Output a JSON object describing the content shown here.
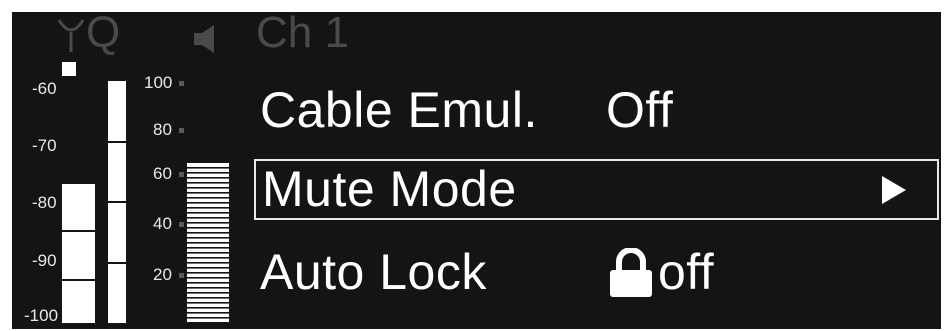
{
  "status_bar": {
    "antenna_label": "Q",
    "channel": "Ch 1"
  },
  "left_scale": {
    "labels": [
      "-60",
      "-70",
      "-80",
      "-90",
      "-100"
    ]
  },
  "right_scale": {
    "labels": [
      "100",
      "80",
      "60",
      "40",
      "20"
    ]
  },
  "meters": {
    "rf_level_percent": 48,
    "af_level_percent": 100,
    "gain_level_percent": 64
  },
  "menu": {
    "items": [
      {
        "label": "Cable Emul.",
        "value": "Off"
      },
      {
        "label": "Mute Mode",
        "selected": true,
        "arrow": "▶"
      },
      {
        "label": "Auto Lock",
        "value": "off",
        "icon": "lock-icon"
      }
    ]
  },
  "colors": {
    "background": "#141414",
    "foreground": "#ffffff",
    "dimmed": "#4a4a4a"
  }
}
